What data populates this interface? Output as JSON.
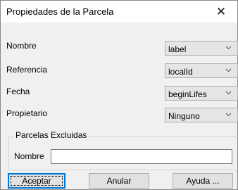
{
  "dialog": {
    "title": "Propiedades de la Parcela",
    "close_glyph": "✕"
  },
  "fields": [
    {
      "label": "Nombre",
      "value": "label"
    },
    {
      "label": "Referencia",
      "value": "localId"
    },
    {
      "label": "Fecha",
      "value": "beginLifes"
    },
    {
      "label": "Propietario",
      "value": "Ninguno"
    }
  ],
  "excluded_group": {
    "legend": "Parcelas Excluidas",
    "name_label": "Nombre",
    "name_value": ""
  },
  "buttons": {
    "accept": "Aceptar",
    "cancel": "Anular",
    "help": "Ayuda ..."
  },
  "colors": {
    "accent": "#0078d7",
    "window_bg": "#f0f0f0"
  }
}
